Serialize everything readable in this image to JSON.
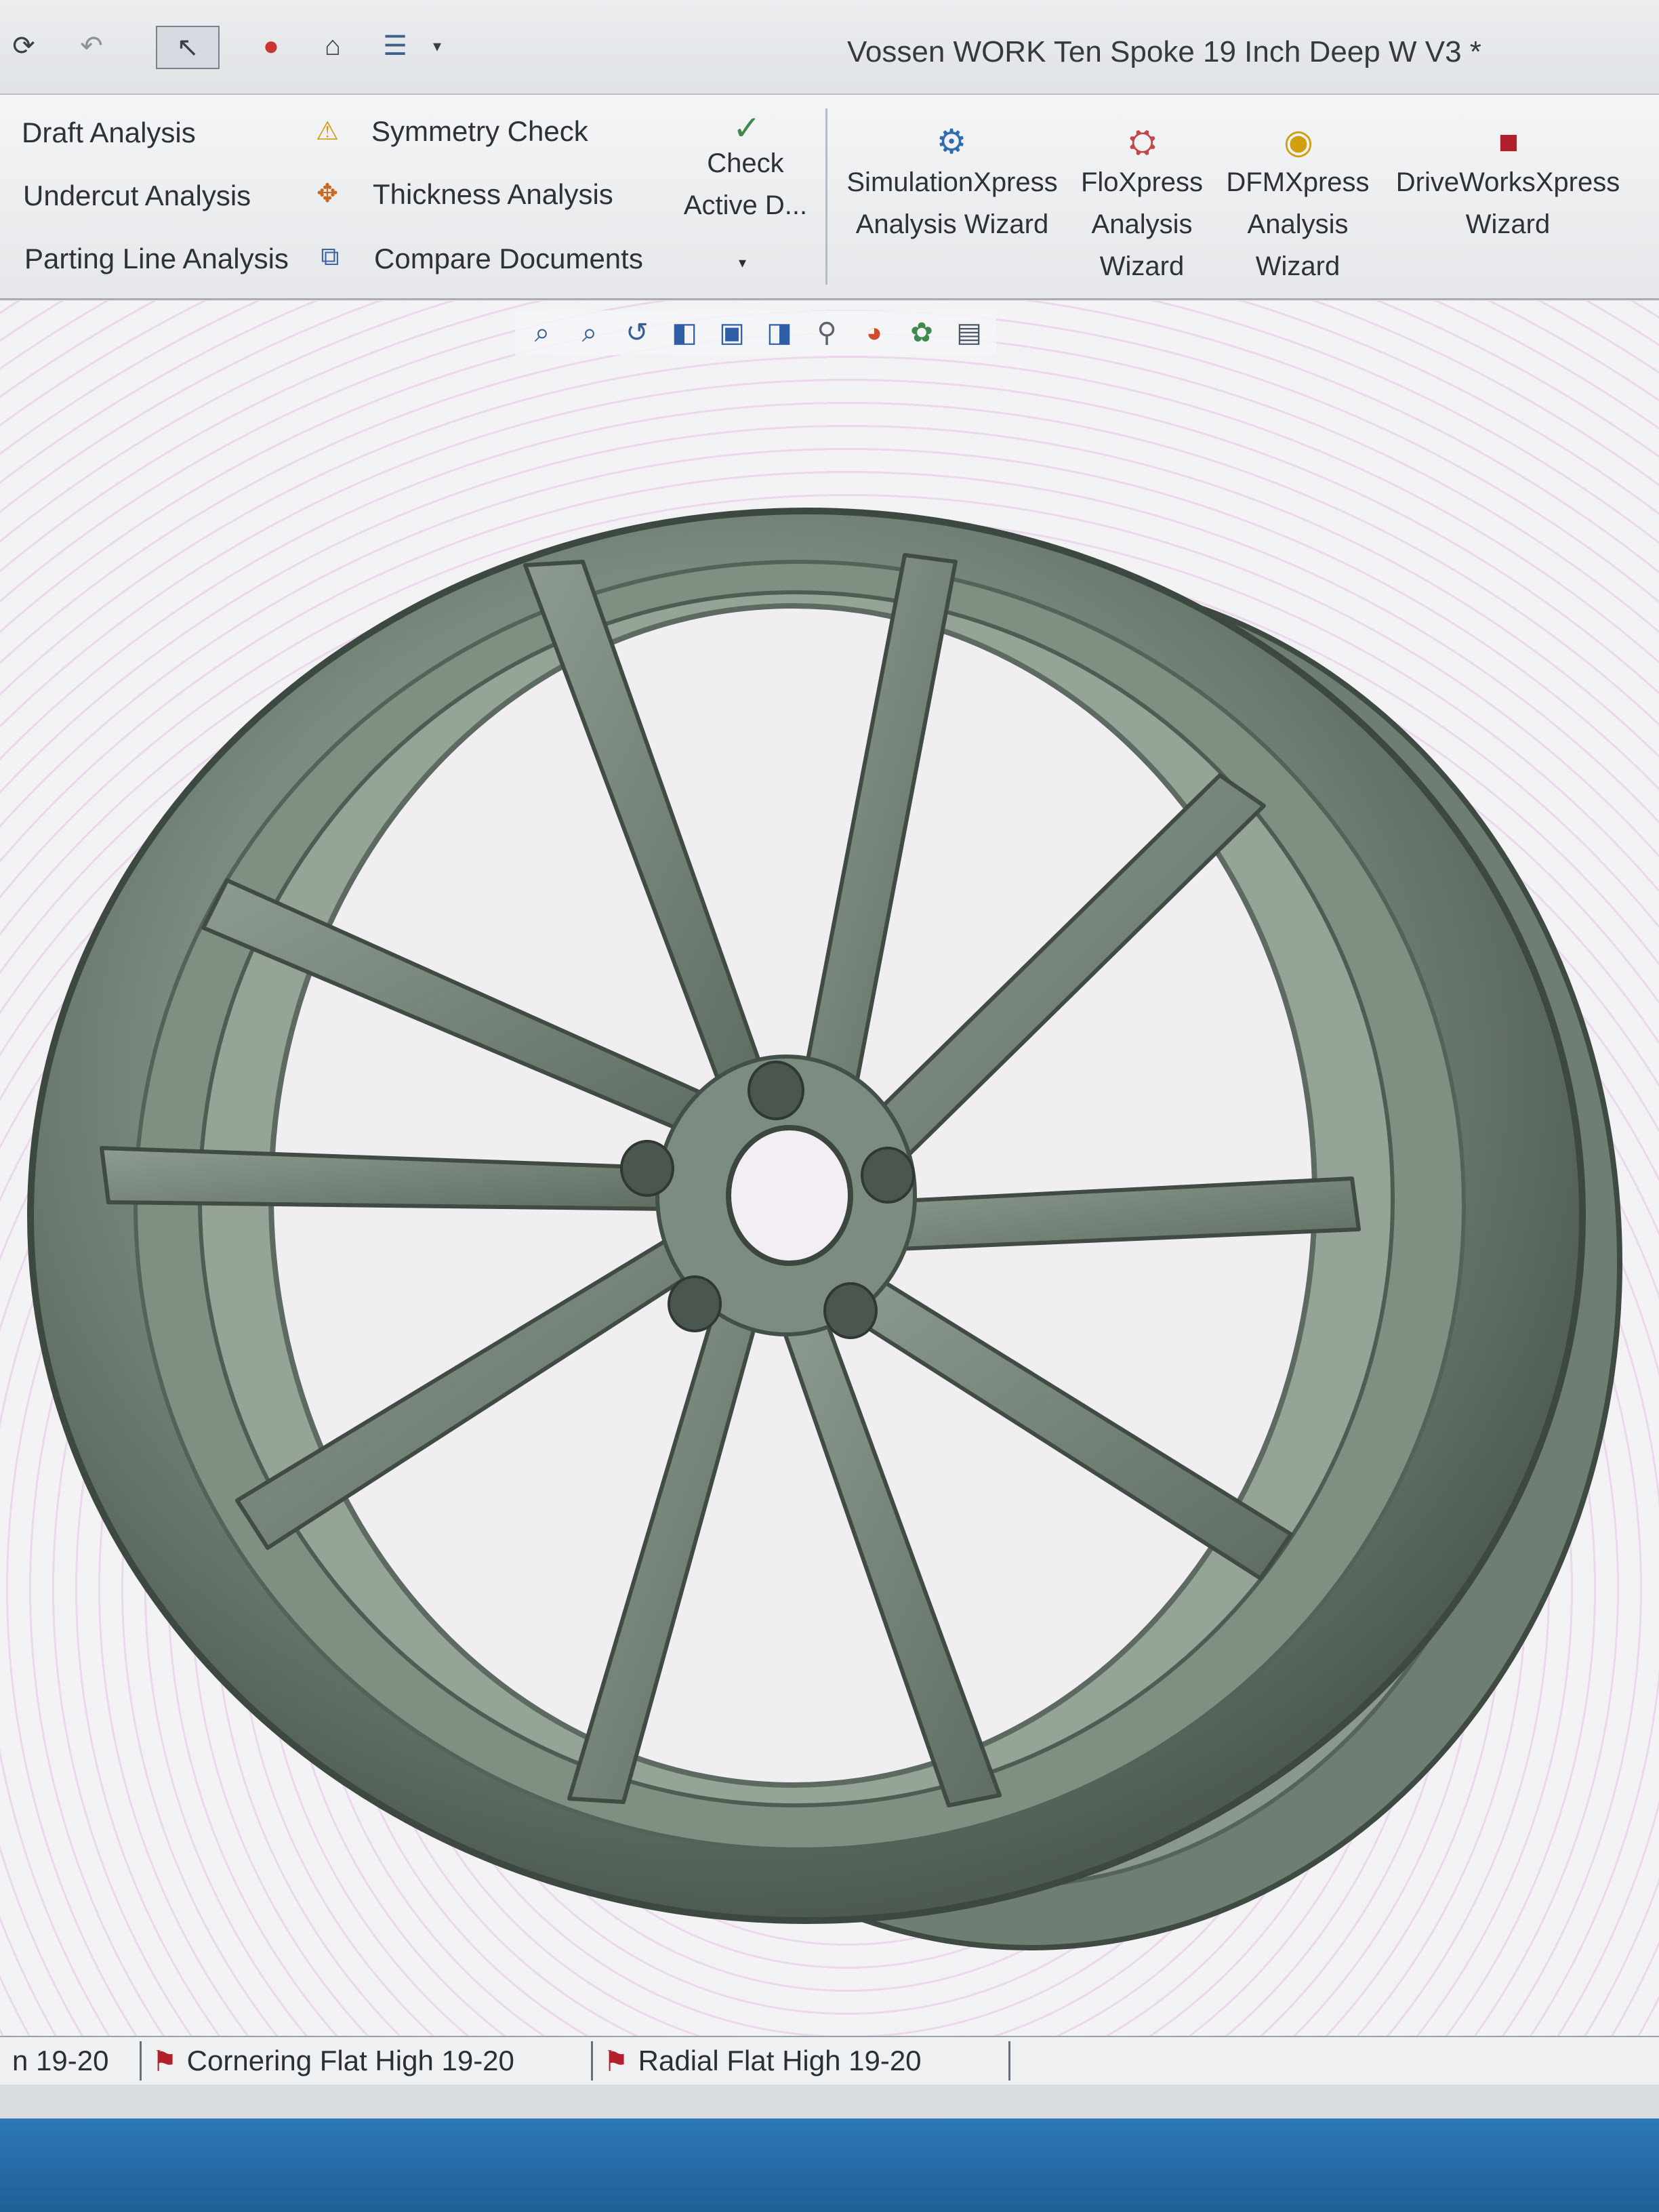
{
  "window": {
    "title": "Vossen WORK Ten Spoke 19 Inch Deep W V3 *"
  },
  "quick_access": [
    {
      "name": "rebuild-icon",
      "glyph": "⟳"
    },
    {
      "name": "undo-icon",
      "glyph": "↶"
    },
    {
      "name": "select-arrow-icon",
      "glyph": "↖"
    },
    {
      "name": "traffic-light-icon",
      "glyph": "●"
    },
    {
      "name": "file-properties-icon",
      "glyph": "⌂"
    },
    {
      "name": "options-list-icon",
      "glyph": "☰"
    }
  ],
  "ribbon": {
    "col1": [
      "Draft Analysis",
      "Undercut Analysis",
      "Parting Line Analysis"
    ],
    "col2": [
      "Symmetry Check",
      "Thickness Analysis",
      "Compare Documents"
    ],
    "check_active": {
      "line1": "Check",
      "line2": "Active D..."
    },
    "wizards": [
      {
        "lines": [
          "SimulationXpress",
          "Analysis Wizard"
        ]
      },
      {
        "lines": [
          "FloXpress",
          "Analysis",
          "Wizard"
        ]
      },
      {
        "lines": [
          "DFMXpress",
          "Analysis",
          "Wizard"
        ]
      },
      {
        "lines": [
          "DriveWorksXpress",
          "Wizard"
        ]
      }
    ]
  },
  "heads_up_toolbar": [
    {
      "name": "zoom-to-fit-icon",
      "glyph": "⌕"
    },
    {
      "name": "zoom-to-area-icon",
      "glyph": "⌕"
    },
    {
      "name": "previous-view-icon",
      "glyph": "↺"
    },
    {
      "name": "section-view-icon",
      "glyph": "◧"
    },
    {
      "name": "view-orientation-icon",
      "glyph": "▣"
    },
    {
      "name": "display-style-icon",
      "glyph": "◨"
    },
    {
      "name": "hide-show-items-icon",
      "glyph": "⚲"
    },
    {
      "name": "edit-appearance-icon",
      "glyph": "◕"
    },
    {
      "name": "apply-scene-icon",
      "glyph": "✿"
    },
    {
      "name": "view-settings-icon",
      "glyph": "▤"
    }
  ],
  "bottom_tabs": [
    "n 19-20",
    "Cornering Flat High 19-20",
    "Radial Flat High 19-20"
  ],
  "colors": {
    "wheel": "#7a8a7e",
    "wheel_dark": "#4d5a51",
    "wheel_light": "#a9b6ab",
    "accent": "#2d78b6"
  }
}
